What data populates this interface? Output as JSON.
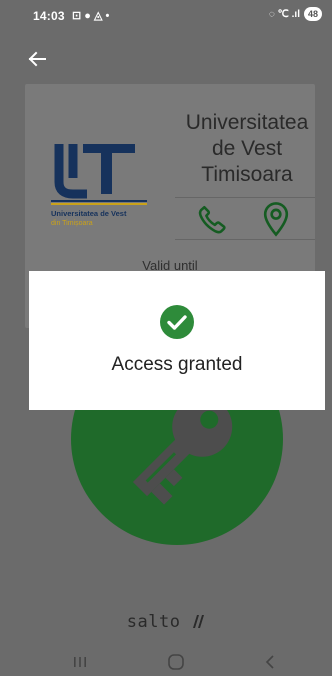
{
  "status_bar": {
    "time": "14:03",
    "left_icons": "⊡ ● ◬ •",
    "right_icons": "◌ ℃ .ıl",
    "battery": "48"
  },
  "header": {
    "back_icon": "arrow-left-icon"
  },
  "card": {
    "logo": {
      "caption_line1": "Universitatea de Vest",
      "caption_line2": "din Timișoara"
    },
    "org_name_line1": "Universitatea",
    "org_name_line2": "de Vest",
    "org_name_line3": "Timisoara",
    "valid_label": "Valid until",
    "contact_icons": [
      "phone-icon",
      "location-icon"
    ]
  },
  "dialog": {
    "message": "Access granted",
    "icon": "check-circle-icon"
  },
  "footer": {
    "brand": "salto"
  },
  "colors": {
    "accent_green": "#2e8b3a",
    "key_circle": "#1f6a2a",
    "scrim": "#6b6b6b"
  }
}
